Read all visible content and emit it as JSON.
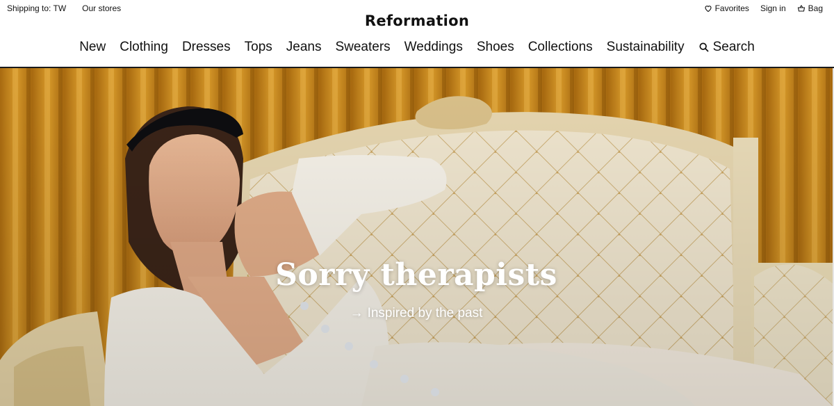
{
  "topbar": {
    "shipping": "Shipping to: TW",
    "stores": "Our stores",
    "favorites": "Favorites",
    "sign_in": "Sign in",
    "bag": "Bag"
  },
  "brand": "Reformation",
  "nav": {
    "items": [
      "New",
      "Clothing",
      "Dresses",
      "Tops",
      "Jeans",
      "Sweaters",
      "Weddings",
      "Shoes",
      "Collections",
      "Sustainability"
    ],
    "search": "Search"
  },
  "hero": {
    "title": "Sorry therapists",
    "link_arrow": "→",
    "link": "Inspired by the past",
    "colors": {
      "curtain": "#c98a1c",
      "sofa": "#ede2c8",
      "dress": "#f3efe6"
    }
  },
  "icons": {
    "favorites": "heart-icon",
    "bag": "bag-icon",
    "search": "search-icon"
  }
}
